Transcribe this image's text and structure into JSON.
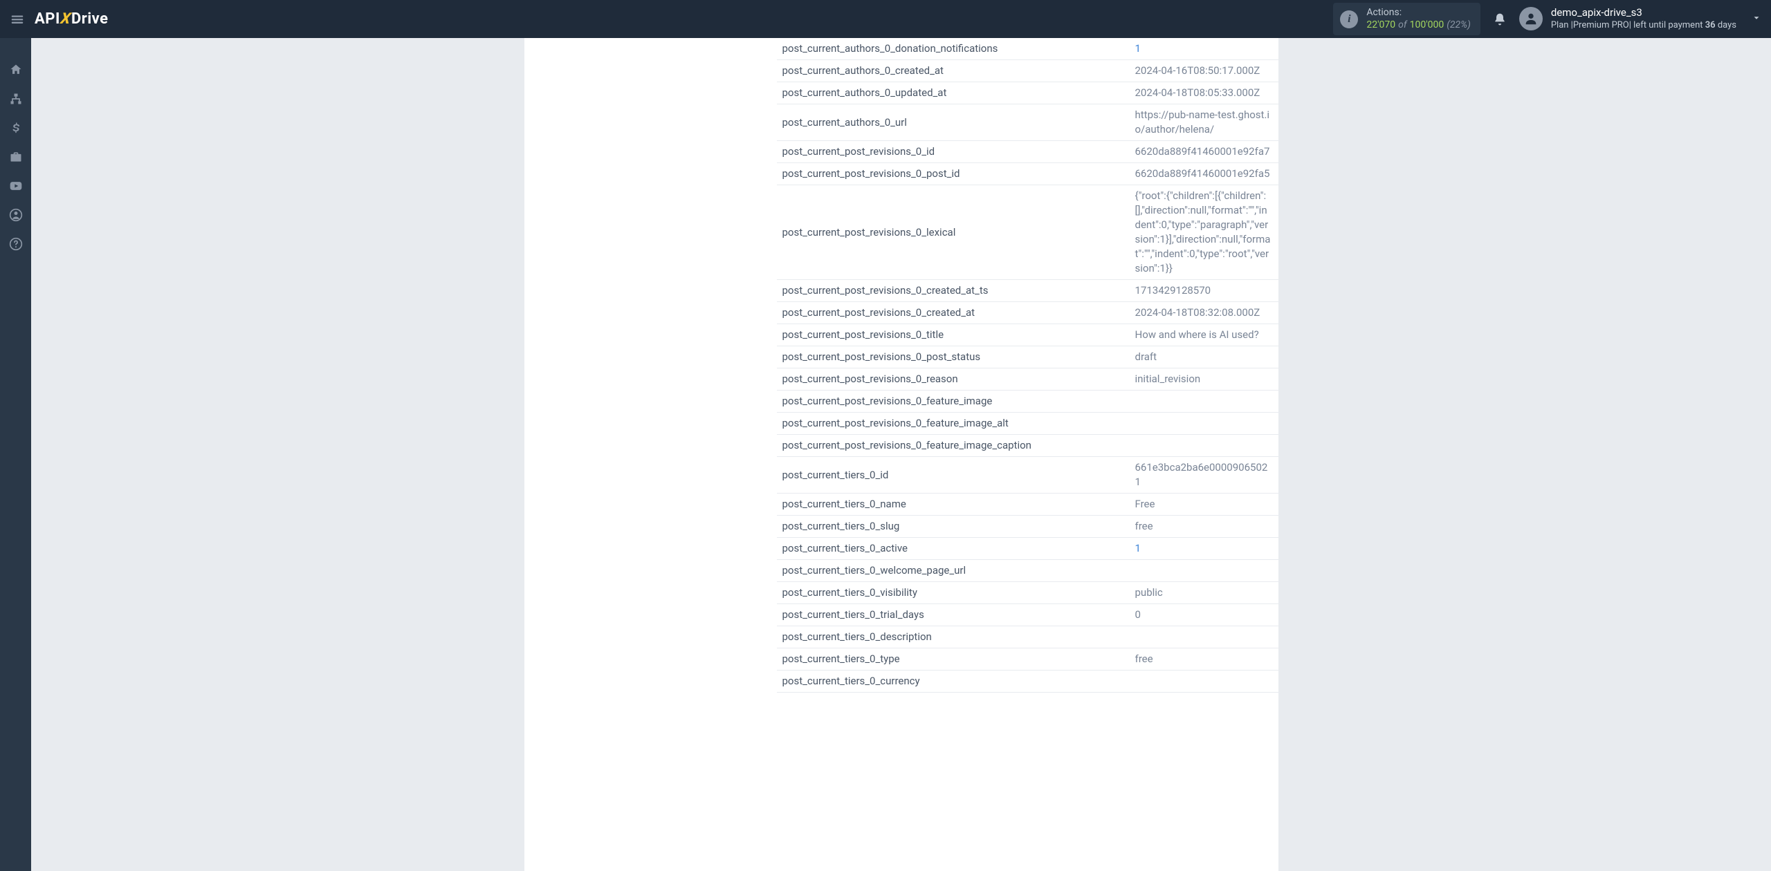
{
  "header": {
    "logo_pre": "API",
    "logo_x": "X",
    "logo_post": "Drive",
    "actions_label": "Actions:",
    "actions_current": "22'070",
    "actions_of": "of",
    "actions_total": "100'000",
    "actions_pct": "(22%)",
    "username": "demo_apix-drive_s3",
    "plan_prefix": "Plan |",
    "plan_name": "Premium PRO",
    "plan_mid": "| left until payment ",
    "plan_days": "36",
    "plan_suffix": " days"
  },
  "rows": [
    {
      "key": "post_current_authors_0_donation_notifications",
      "value": "1",
      "highlight": true
    },
    {
      "key": "post_current_authors_0_created_at",
      "value": "2024-04-16T08:50:17.000Z"
    },
    {
      "key": "post_current_authors_0_updated_at",
      "value": "2024-04-18T08:05:33.000Z"
    },
    {
      "key": "post_current_authors_0_url",
      "value": "https://pub-name-test.ghost.io/author/helena/"
    },
    {
      "key": "post_current_post_revisions_0_id",
      "value": "6620da889f41460001e92fa7"
    },
    {
      "key": "post_current_post_revisions_0_post_id",
      "value": "6620da889f41460001e92fa5"
    },
    {
      "key": "post_current_post_revisions_0_lexical",
      "value": "{\"root\":{\"children\":[{\"children\":[],\"direction\":null,\"format\":\"\",\"indent\":0,\"type\":\"paragraph\",\"version\":1}],\"direction\":null,\"format\":\"\",\"indent\":0,\"type\":\"root\",\"version\":1}}"
    },
    {
      "key": "post_current_post_revisions_0_created_at_ts",
      "value": "1713429128570"
    },
    {
      "key": "post_current_post_revisions_0_created_at",
      "value": "2024-04-18T08:32:08.000Z"
    },
    {
      "key": "post_current_post_revisions_0_title",
      "value": "How and where is AI used?"
    },
    {
      "key": "post_current_post_revisions_0_post_status",
      "value": "draft"
    },
    {
      "key": "post_current_post_revisions_0_reason",
      "value": "initial_revision"
    },
    {
      "key": "post_current_post_revisions_0_feature_image",
      "value": ""
    },
    {
      "key": "post_current_post_revisions_0_feature_image_alt",
      "value": ""
    },
    {
      "key": "post_current_post_revisions_0_feature_image_caption",
      "value": ""
    },
    {
      "key": "post_current_tiers_0_id",
      "value": "661e3bca2ba6e00009065021"
    },
    {
      "key": "post_current_tiers_0_name",
      "value": "Free"
    },
    {
      "key": "post_current_tiers_0_slug",
      "value": "free"
    },
    {
      "key": "post_current_tiers_0_active",
      "value": "1",
      "highlight": true
    },
    {
      "key": "post_current_tiers_0_welcome_page_url",
      "value": ""
    },
    {
      "key": "post_current_tiers_0_visibility",
      "value": "public"
    },
    {
      "key": "post_current_tiers_0_trial_days",
      "value": "0"
    },
    {
      "key": "post_current_tiers_0_description",
      "value": ""
    },
    {
      "key": "post_current_tiers_0_type",
      "value": "free"
    },
    {
      "key": "post_current_tiers_0_currency",
      "value": ""
    }
  ]
}
